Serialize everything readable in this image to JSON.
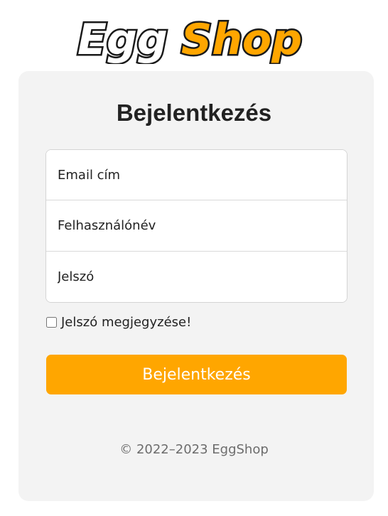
{
  "logo": {
    "text_part1": "Egg",
    "text_part2": "Shop",
    "colors": {
      "part1": "#ffffff",
      "part2": "#ffa600",
      "outline": "#1a1a1a"
    }
  },
  "form": {
    "title": "Bejelentkezés",
    "email_placeholder": "Email cím",
    "username_placeholder": "Felhasználónév",
    "password_placeholder": "Jelszó",
    "remember_label": "Jelszó megjegyzése!",
    "remember_checked": false,
    "submit_label": "Bejelentkezés"
  },
  "footer": {
    "copyright": "© 2022–2023 EggShop"
  },
  "colors": {
    "accent": "#ffa600",
    "panel_bg": "#f3f3f3",
    "footer_text": "#6c6c6c"
  }
}
